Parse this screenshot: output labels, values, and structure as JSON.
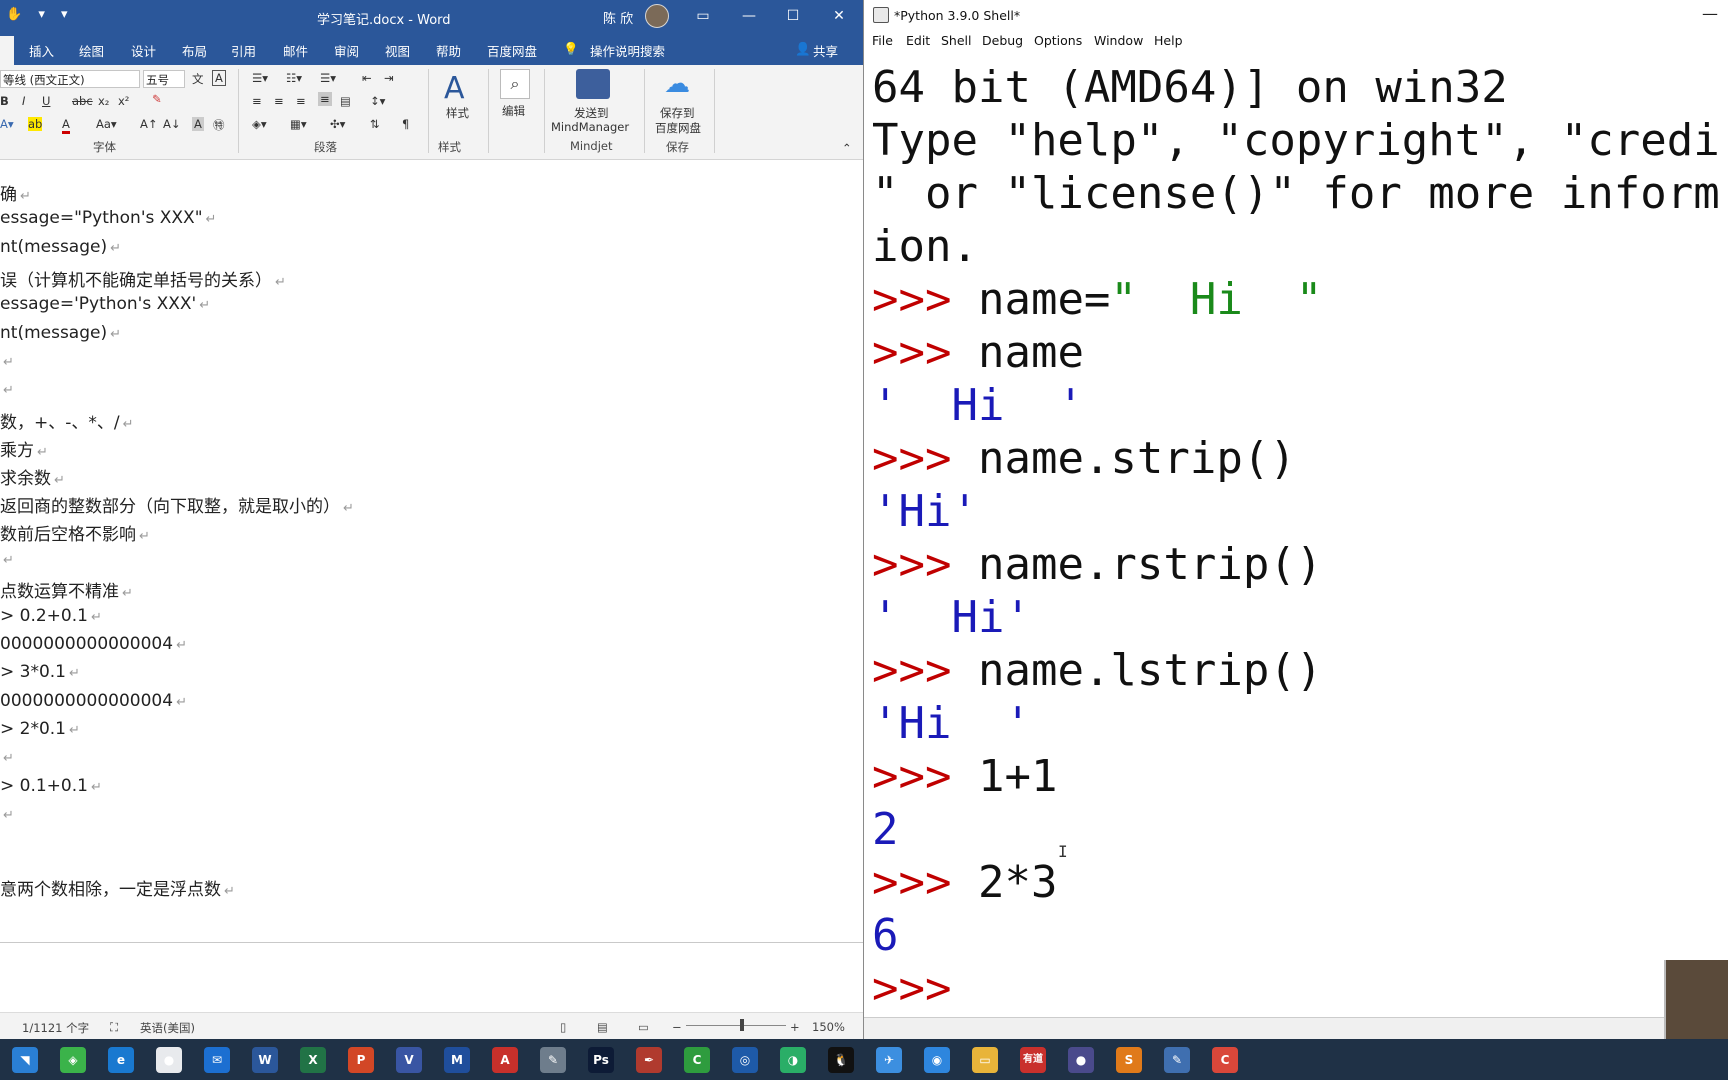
{
  "word": {
    "title": "学习笔记.docx  -  Word",
    "user": "陈 欣",
    "tabs": [
      "插入",
      "绘图",
      "设计",
      "布局",
      "引用",
      "邮件",
      "审阅",
      "视图",
      "帮助",
      "百度网盘",
      "操作说明搜索",
      "共享"
    ],
    "ribbon": {
      "font_name": "等线 (西文正文)",
      "font_size": "五号",
      "group_font": "字体",
      "group_paragraph": "段落",
      "group_styles": "样式",
      "styles_label": "样式",
      "edit_label": "编辑",
      "mindjet_label_1": "发送到",
      "mindjet_label_2": "MindManager",
      "group_mindjet": "Mindjet",
      "baidu_label_1": "保存到",
      "baidu_label_2": "百度网盘",
      "group_save": "保存"
    },
    "doc_lines": [
      "确",
      "essage=\"Python's XXX\"",
      "nt(message)",
      "误（计算机不能确定单括号的关系）",
      "essage='Python's XXX'",
      "nt(message)",
      "",
      "",
      "数，+、-、*、/",
      "  乘方",
      "  求余数",
      "  返回商的整数部分（向下取整，就是取小的）",
      "数前后空格不影响",
      "",
      "点数运算不精准",
      "> 0.2+0.1",
      "0000000000000004",
      "> 3*0.1",
      "0000000000000004",
      "> 2*0.1",
      "",
      "> 0.1+0.1",
      "",
      "意两个数相除，一定是浮点数"
    ],
    "paragraph_mark": "↵",
    "status": {
      "page": "1/1121 个字",
      "lang": "英语(美国)",
      "zoom": "150%"
    }
  },
  "shell": {
    "title": "*Python 3.9.0 Shell*",
    "menu": [
      "File",
      "Edit",
      "Shell",
      "Debug",
      "Options",
      "Window",
      "Help"
    ],
    "banner_lines": [
      "64 bit (AMD64)] on win32",
      "Type \"help\", \"copyright\", \"credi",
      "\" or \"license()\" for more inform",
      "ion."
    ],
    "session": [
      {
        "prompt": ">>> ",
        "code": "name=",
        "string": "\"  Hi  \""
      },
      {
        "prompt": ">>> ",
        "code": "name"
      },
      {
        "output": "'  Hi  '"
      },
      {
        "prompt": ">>> ",
        "code": "name.strip()"
      },
      {
        "output": "'Hi'"
      },
      {
        "prompt": ">>> ",
        "code": "name.rstrip()"
      },
      {
        "output": "'  Hi'"
      },
      {
        "prompt": ">>> ",
        "code": "name.lstrip()"
      },
      {
        "output": "'Hi  '"
      },
      {
        "prompt": ">>> ",
        "code": "1+1"
      },
      {
        "output": "2"
      },
      {
        "prompt": ">>> ",
        "code": "2*3"
      },
      {
        "output": "6"
      },
      {
        "prompt": ">>> ",
        "code": ""
      }
    ]
  },
  "taskbar": {
    "items": [
      "start-icon",
      "cortana-icon",
      "edge-icon",
      "chrome-icon",
      "mail-icon",
      "word-icon",
      "excel-icon",
      "powerpoint-icon",
      "visio-icon",
      "mindmanager-icon",
      "pdf-icon",
      "notes-icon",
      "photoshop-icon",
      "python-feather-icon",
      "camtasia-icon",
      "ink-icon",
      "wechat-icon",
      "qq-icon",
      "dingtalk-icon",
      "browser-icon",
      "folder-icon",
      "youdao-icon",
      "eclipse-icon",
      "sublime-icon",
      "python-icon",
      "camtasia-recorder-icon"
    ],
    "labels": [
      "有道"
    ]
  }
}
